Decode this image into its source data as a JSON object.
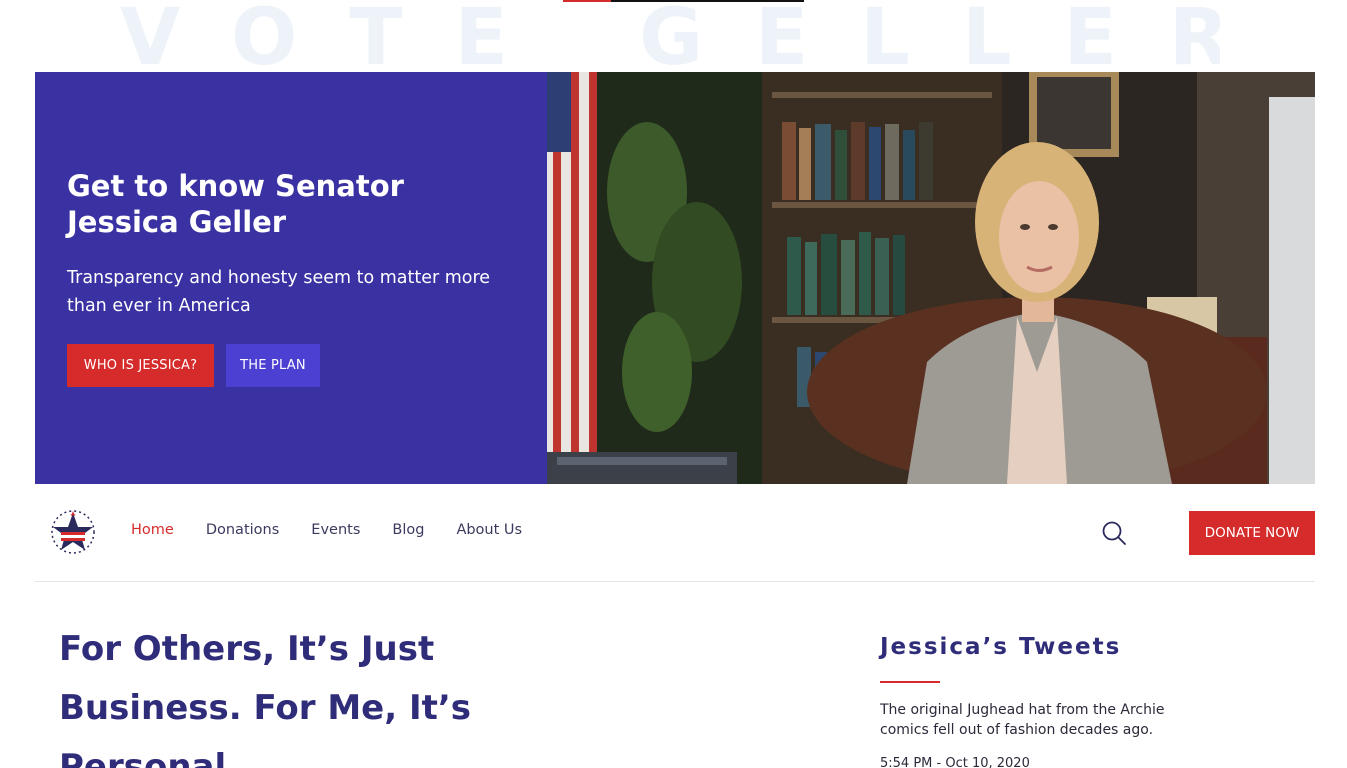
{
  "watermark": "VOTE GELLER",
  "progress": {
    "percent": 20,
    "color": "#d62b2b"
  },
  "hero": {
    "title": "Get to know Senator Jessica Geller",
    "subtitle": "Transparency and honesty seem to matter more than ever in America",
    "primary_button": "WHO IS JESSICA?",
    "secondary_button": "THE PLAN",
    "panel_color": "#3a31a3"
  },
  "nav": {
    "items": [
      {
        "label": "Home",
        "active": true
      },
      {
        "label": "Donations",
        "active": false
      },
      {
        "label": "Events",
        "active": false
      },
      {
        "label": "Blog",
        "active": false
      },
      {
        "label": "About Us",
        "active": false
      }
    ],
    "search_icon": "search-icon",
    "donate_label": "DONATE NOW"
  },
  "main": {
    "headline": "For Others, It’s Just Business. For Me, It’s Personal"
  },
  "tweets": {
    "title": "Jessica’s Tweets",
    "items": [
      {
        "text": "The original Jughead hat from the Archie comics fell out of fashion decades ago.",
        "time": "5:54 PM - Oct 10, 2020"
      }
    ]
  },
  "colors": {
    "accent_red": "#d62b2b",
    "brand_blue": "#2f2c7a",
    "button_blue": "#4c40d2"
  }
}
